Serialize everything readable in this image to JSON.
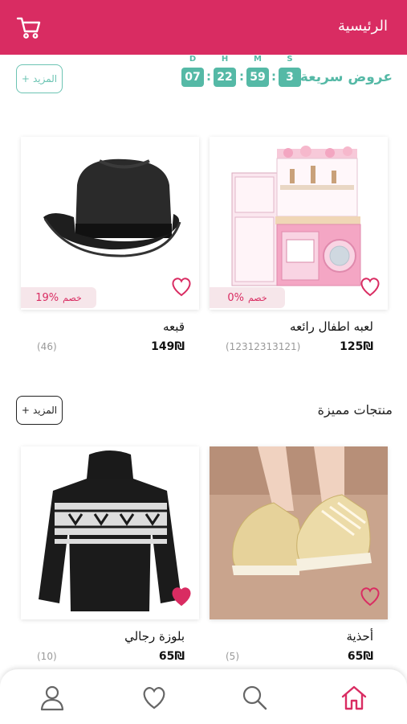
{
  "header": {
    "title": "الرئيسية"
  },
  "flash": {
    "title": "عروض سريعة!",
    "more_label": "المزيد",
    "timer": [
      {
        "label": "D",
        "value": "07"
      },
      {
        "label": "H",
        "value": "22"
      },
      {
        "label": "M",
        "value": "59"
      },
      {
        "label": "S",
        "value": "3"
      }
    ]
  },
  "flash_products": [
    {
      "name": "لعبه اطفال رائعه",
      "price": "125₪",
      "reviews": "(12312313121)",
      "discount_label": "خصم",
      "discount": "0%",
      "favorite": false
    },
    {
      "name": "قبعه",
      "price": "149₪",
      "reviews": "(46)",
      "discount_label": "خصم",
      "discount": "19%",
      "favorite": false
    }
  ],
  "featured": {
    "title": "منتجات مميزة",
    "more_label": "المزيد"
  },
  "featured_products": [
    {
      "name": "أحذية",
      "price": "65₪",
      "reviews": "(5)",
      "favorite": false
    },
    {
      "name": "بلوزة رجالي",
      "price": "65₪",
      "reviews": "(10)",
      "favorite": true
    }
  ],
  "colors": {
    "primary": "#d92c62",
    "accent": "#55b9a6"
  },
  "nav": [
    "home-icon",
    "search-icon",
    "heart-icon",
    "user-icon"
  ]
}
